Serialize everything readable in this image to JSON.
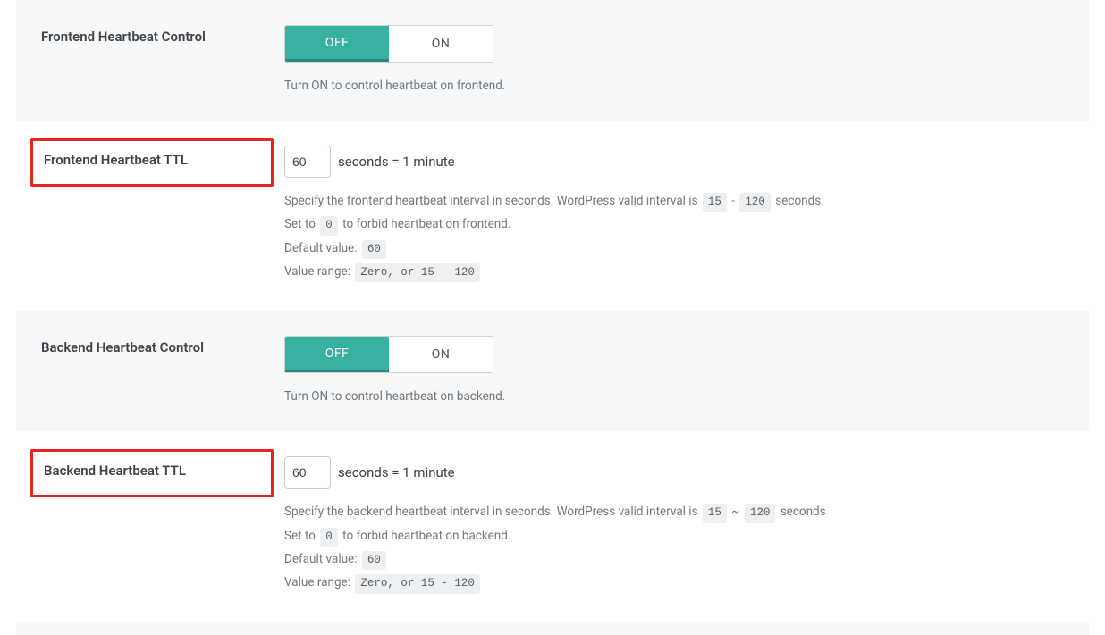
{
  "toggle": {
    "off": "OFF",
    "on": "ON"
  },
  "rows": {
    "frontendControl": {
      "label": "Frontend Heartbeat Control",
      "help": "Turn ON to control heartbeat on frontend."
    },
    "frontendTtl": {
      "label": "Frontend Heartbeat TTL",
      "value": "60",
      "unitText": "seconds = 1 minute",
      "help": {
        "line1_a": "Specify the frontend heartbeat interval in seconds. WordPress valid interval is ",
        "min": "15",
        "dash": " - ",
        "max": "120",
        "line1_b": " seconds.",
        "line2_a": "Set to ",
        "zero": "0",
        "line2_b": " to forbid heartbeat on frontend.",
        "default_label": "Default value: ",
        "default_val": "60",
        "range_label": "Value range: ",
        "range_val": "Zero, or 15 - 120"
      }
    },
    "backendControl": {
      "label": "Backend Heartbeat Control",
      "help": "Turn ON to control heartbeat on backend."
    },
    "backendTtl": {
      "label": "Backend Heartbeat TTL",
      "value": "60",
      "unitText": "seconds = 1 minute",
      "help": {
        "line1_a": "Specify the backend heartbeat interval in seconds. WordPress valid interval is ",
        "min": "15",
        "dash": " ~ ",
        "max": "120",
        "line1_b": " seconds",
        "line2_a": "Set to ",
        "zero": "0",
        "line2_b": " to forbid heartbeat on backend.",
        "default_label": "Default value: ",
        "default_val": "60",
        "range_label": "Value range: ",
        "range_val": "Zero, or 15 - 120"
      }
    }
  }
}
